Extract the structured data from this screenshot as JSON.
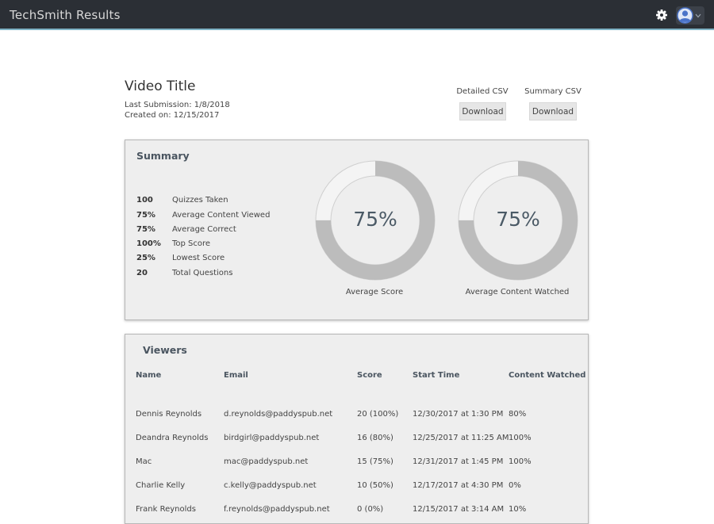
{
  "header": {
    "title": "TechSmith Results",
    "icons": [
      "gear-icon",
      "user-avatar-icon",
      "chevron-down-icon"
    ]
  },
  "video": {
    "title": "Video Title",
    "last_submission": "Last Submission: 1/8/2018",
    "created_on": "Created on: 12/15/2017"
  },
  "exports": {
    "detailed_label": "Detailed CSV",
    "summary_label": "Summary CSV",
    "download_label": "Download"
  },
  "summary": {
    "heading": "Summary",
    "stats": [
      {
        "value": "100",
        "label": "Quizzes Taken"
      },
      {
        "value": "75%",
        "label": "Average Content Viewed"
      },
      {
        "value": "75%",
        "label": "Average Correct"
      },
      {
        "value": "100%",
        "label": "Top Score"
      },
      {
        "value": "25%",
        "label": "Lowest Score"
      },
      {
        "value": "20",
        "label": "Total Questions"
      }
    ],
    "charts": [
      {
        "value": "75%",
        "fraction": 0.75,
        "caption": "Average Score"
      },
      {
        "value": "75%",
        "fraction": 0.75,
        "caption": "Average Content Watched"
      }
    ],
    "colors": {
      "ring_fill": "#bcbcbc",
      "ring_track": "#f4f4f4"
    }
  },
  "viewers": {
    "heading": "Viewers",
    "columns": [
      "Name",
      "Email",
      "Score",
      "Start Time",
      "Content Watched"
    ],
    "rows": [
      {
        "name": "Dennis Reynolds",
        "email": "d.reynolds@paddyspub.net",
        "score": "20 (100%)",
        "start": "12/30/2017 at 1:30 PM",
        "watched": "80%"
      },
      {
        "name": "Deandra Reynolds",
        "email": "birdgirl@paddyspub.net",
        "score": "16 (80%)",
        "start": "12/25/2017 at 11:25 AM",
        "watched": "100%"
      },
      {
        "name": "Mac",
        "email": "mac@paddyspub.net",
        "score": "15 (75%)",
        "start": "12/31/2017 at 1:45 PM",
        "watched": "100%"
      },
      {
        "name": "Charlie Kelly",
        "email": "c.kelly@paddyspub.net",
        "score": "10 (50%)",
        "start": "12/17/2017 at 4:30 PM",
        "watched": "0%"
      },
      {
        "name": "Frank Reynolds",
        "email": "f.reynolds@paddyspub.net",
        "score": "0 (0%)",
        "start": "12/15/2017 at 3:14 AM",
        "watched": "10%"
      }
    ]
  }
}
